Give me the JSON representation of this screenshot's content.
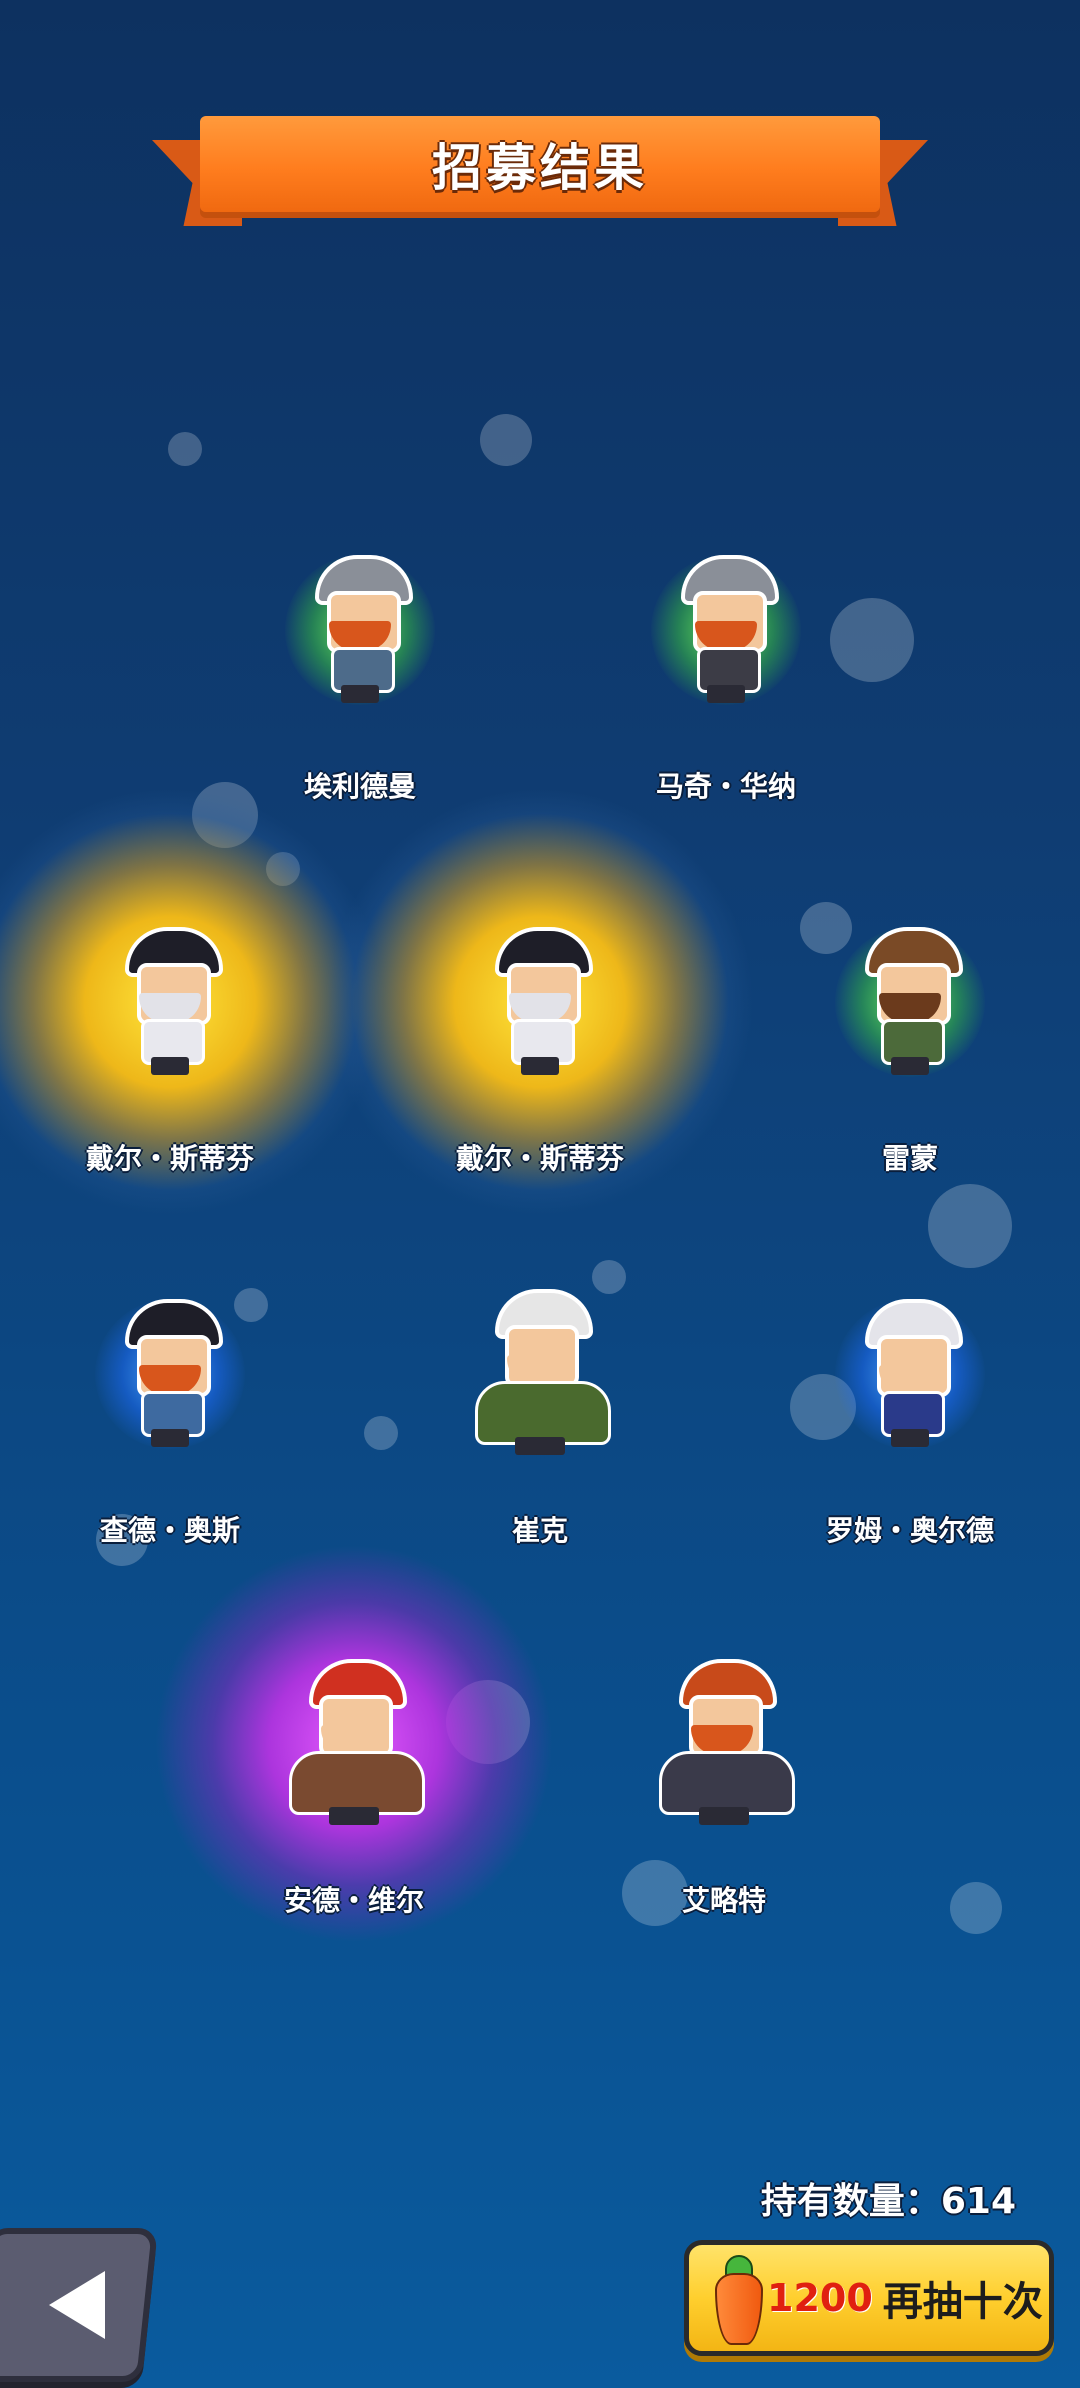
{
  "header": {
    "title": "招募结果"
  },
  "heroes": [
    {
      "name": "埃利德曼",
      "glow": "green",
      "hat_color": "#8a8f98",
      "beard_color": "#d8561c",
      "body_color": "#4d6b8a",
      "size": "normal"
    },
    {
      "name": "马奇・华纳",
      "glow": "green",
      "hat_color": "#8a8f98",
      "beard_color": "#d8561c",
      "body_color": "#3c3c46",
      "size": "normal"
    },
    {
      "name": "戴尔・斯蒂芬",
      "glow": "gold",
      "hat_color": "#1e1e28",
      "beard_color": "#e2e2e8",
      "body_color": "#e8e8ee",
      "size": "normal"
    },
    {
      "name": "戴尔・斯蒂芬",
      "glow": "gold",
      "hat_color": "#1e1e28",
      "beard_color": "#e2e2e8",
      "body_color": "#e8e8ee",
      "size": "normal"
    },
    {
      "name": "雷蒙",
      "glow": "green",
      "hat_color": "#7a4a26",
      "beard_color": "#6b3a1c",
      "body_color": "#4c6a3a",
      "size": "normal"
    },
    {
      "name": "查德・奥斯",
      "glow": "blue",
      "hat_color": "#1e1e28",
      "beard_color": "#d8561c",
      "body_color": "#3e6aa0",
      "size": "normal"
    },
    {
      "name": "崔克",
      "glow": "none",
      "hat_color": "#e6e6e6",
      "beard_color": "#f3c79c",
      "body_color": "#4a6a2e",
      "size": "big"
    },
    {
      "name": "罗姆・奥尔德",
      "glow": "blue",
      "hat_color": "#e4e4ea",
      "beard_color": "#f3c79c",
      "body_color": "#2a3a8a",
      "size": "normal"
    },
    {
      "name": "安德・维尔",
      "glow": "purple",
      "hat_color": "#d03020",
      "beard_color": "#f3c79c",
      "body_color": "#7a4a30",
      "size": "big"
    },
    {
      "name": "艾略特",
      "glow": "none",
      "hat_color": "#c84a1a",
      "beard_color": "#d8561c",
      "body_color": "#3a3a4a",
      "size": "big"
    }
  ],
  "footer": {
    "owned_label": "持有数量：",
    "owned_count": "614",
    "recruit_cost": "1200",
    "recruit_label": "再抽十次"
  },
  "icons": {
    "back": "back-arrow-icon",
    "currency": "carrot-icon"
  }
}
